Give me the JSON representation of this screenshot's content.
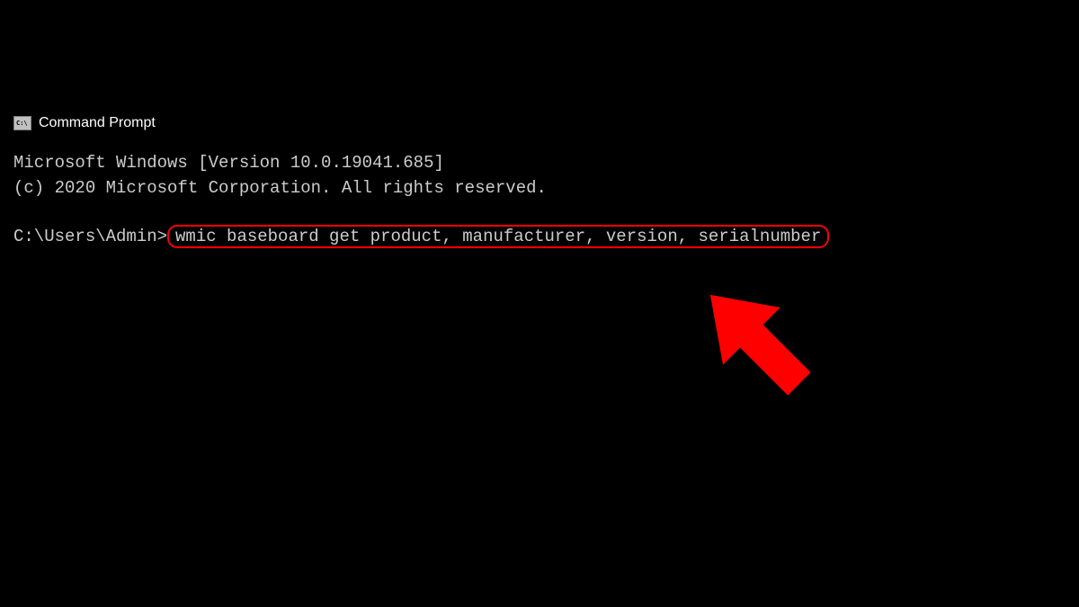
{
  "window": {
    "title": "Command Prompt"
  },
  "terminal": {
    "header_line1": "Microsoft Windows [Version 10.0.19041.685]",
    "header_line2": "(c) 2020 Microsoft Corporation. All rights reserved.",
    "prompt": "C:\\Users\\Admin>",
    "command": "wmic baseboard get product, manufacturer, version, serialnumber"
  },
  "annotation": {
    "highlight_color": "#ff0000",
    "arrow_color": "#ff0000"
  }
}
